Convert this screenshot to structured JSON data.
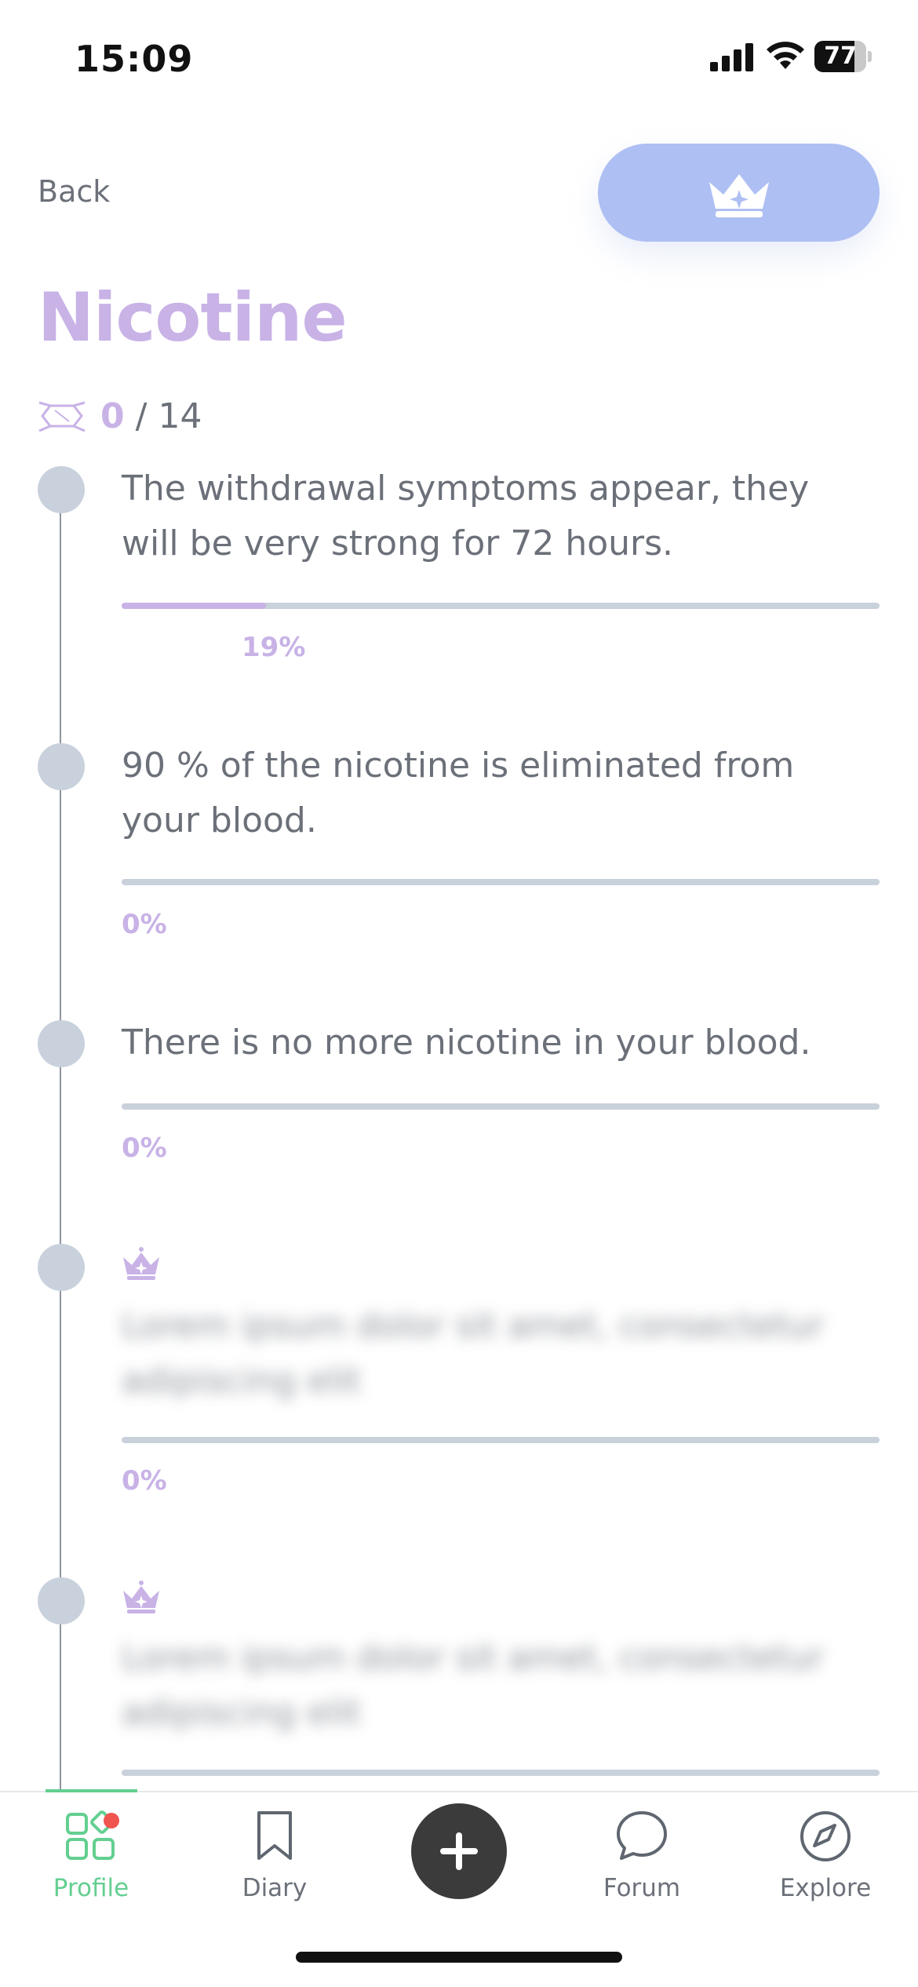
{
  "status_bar": {
    "time": "15:09",
    "battery_level": "77",
    "battery_fraction": 0.77
  },
  "header": {
    "back_label": "Back",
    "premium_icon": "crown-icon",
    "title": "Nicotine"
  },
  "progress": {
    "icon": "molecule-icon",
    "done": "0",
    "separator": "/",
    "total": "14"
  },
  "milestones": [
    {
      "text": "The withdrawal symptoms appear, they will be very strong for 72 hours.",
      "percent_label": "19%",
      "percent": 0.19,
      "locked": false
    },
    {
      "text": "90 % of the nicotine is eliminated from your blood.",
      "percent_label": "0%",
      "percent": 0.0,
      "locked": false
    },
    {
      "text": "There is no more nicotine in your blood.",
      "percent_label": "0%",
      "percent": 0.0,
      "locked": false
    },
    {
      "text": "Lorem ipsum dolor sit amet, consectetur adipiscing elit",
      "percent_label": "0%",
      "percent": 0.0,
      "locked": true,
      "icon": "crown-icon"
    },
    {
      "text": "Lorem ipsum dolor sit amet, consectetur adipiscing elit",
      "percent": 0.0,
      "locked": true,
      "icon": "crown-icon"
    }
  ],
  "colors": {
    "accent_purple": "#c8b2e6",
    "premium_blue": "#aebff3",
    "nav_active_green": "#63cf90",
    "notification_red": "#f0544f"
  },
  "nav": {
    "profile": {
      "label": "Profile",
      "icon": "grid-shapes-icon",
      "active": true,
      "has_notification": true
    },
    "diary": {
      "label": "Diary",
      "icon": "bookmark-icon"
    },
    "add": {
      "icon": "plus-icon"
    },
    "forum": {
      "label": "Forum",
      "icon": "chat-bubble-icon"
    },
    "explore": {
      "label": "Explore",
      "icon": "compass-icon"
    }
  }
}
